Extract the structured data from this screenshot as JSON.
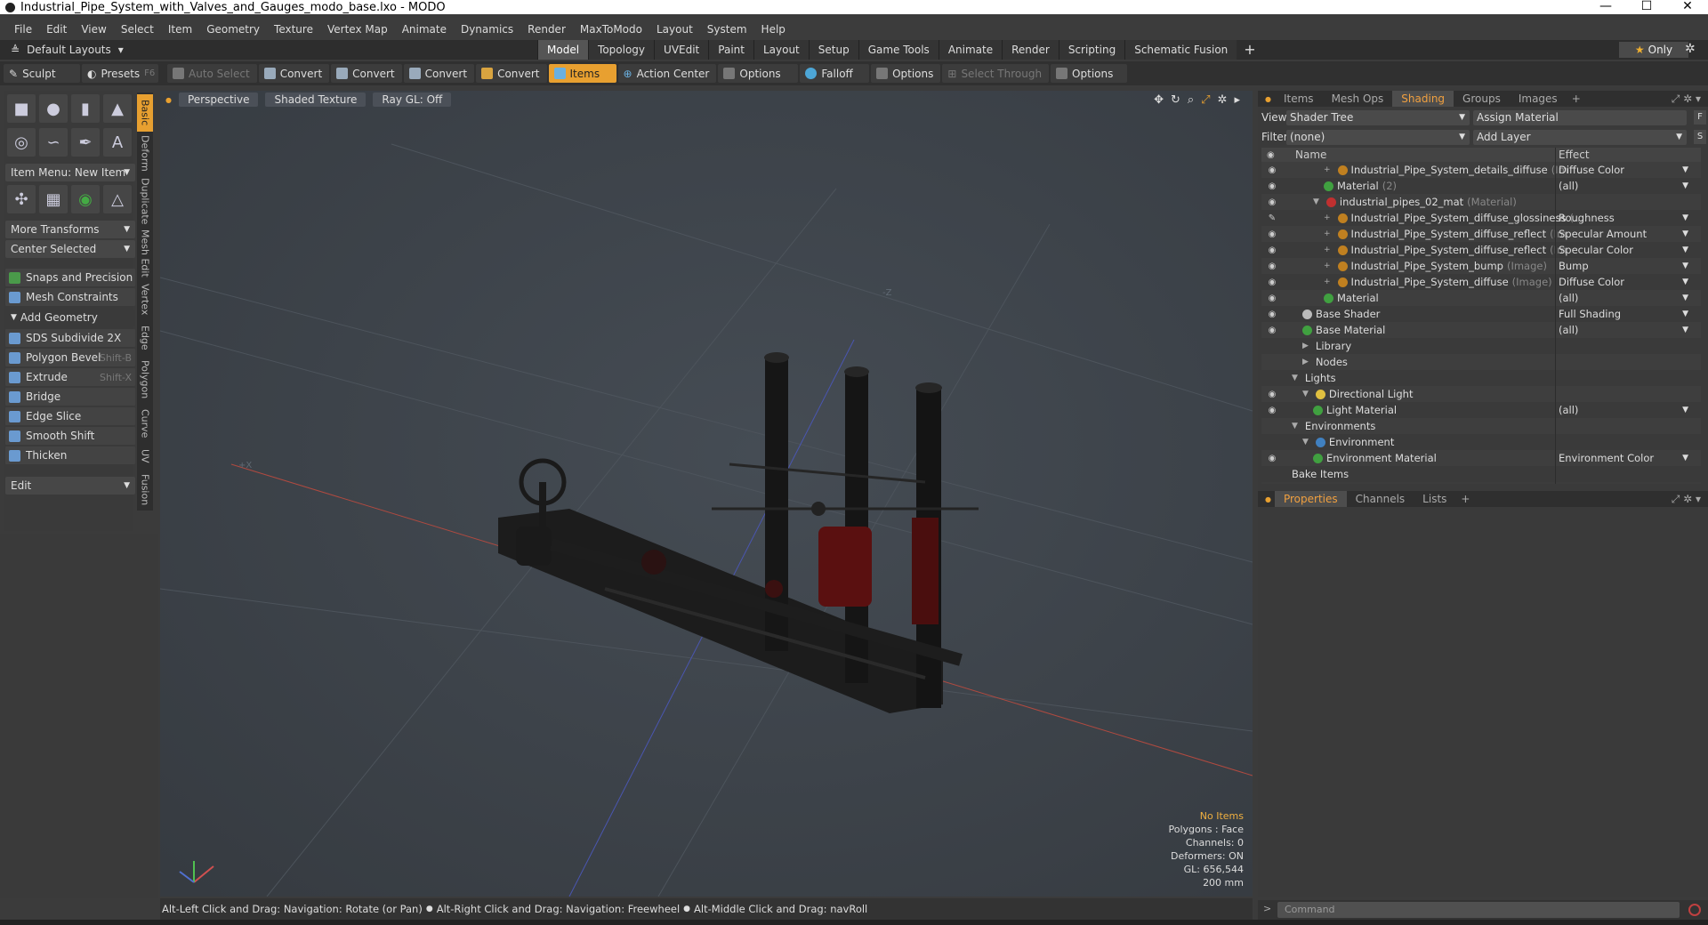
{
  "window": {
    "title": "Industrial_Pipe_System_with_Valves_and_Gauges_modo_base.lxo - MODO",
    "minimize": "—",
    "maximize": "☐",
    "close": "✕"
  },
  "menu": [
    "File",
    "Edit",
    "View",
    "Select",
    "Item",
    "Geometry",
    "Texture",
    "Vertex Map",
    "Animate",
    "Dynamics",
    "Render",
    "MaxToModo",
    "Layout",
    "System",
    "Help"
  ],
  "layouts": {
    "default": "Default Layouts",
    "tabs": [
      "Model",
      "Topology",
      "UVEdit",
      "Paint",
      "Layout",
      "Setup",
      "Game Tools",
      "Animate",
      "Render",
      "Scripting",
      "Schematic Fusion"
    ],
    "active": "Model",
    "only": "Only"
  },
  "toolbar": {
    "sculpt": "Sculpt",
    "presets": "Presets",
    "presets_key": "F6",
    "auto_select": "Auto Select",
    "convert1": "Convert",
    "convert2": "Convert",
    "convert3": "Convert",
    "convert4": "Convert",
    "items": "Items",
    "action_center": "Action Center",
    "options1": "Options",
    "falloff": "Falloff",
    "options2": "Options",
    "select_through": "Select Through",
    "options3": "Options"
  },
  "left": {
    "item_menu": "Item Menu: New Item",
    "more_transforms": "More Transforms",
    "center_selected": "Center Selected",
    "snaps": "Snaps and Precision",
    "mesh_constraints": "Mesh Constraints",
    "add_geometry": "Add Geometry",
    "sds": "SDS Subdivide 2X",
    "polygon_bevel": "Polygon Bevel",
    "polygon_bevel_key": "Shift-B",
    "extrude": "Extrude",
    "extrude_key": "Shift-X",
    "bridge": "Bridge",
    "edge_slice": "Edge Slice",
    "smooth_shift": "Smooth Shift",
    "thicken": "Thicken",
    "edit": "Edit"
  },
  "vtabs": [
    "Basic",
    "Deform",
    "Duplicate",
    "Mesh Edit",
    "Vertex",
    "Edge",
    "Polygon",
    "Curve",
    "UV",
    "Fusion"
  ],
  "viewport": {
    "perspective": "Perspective",
    "shaded": "Shaded Texture",
    "raygl": "Ray GL: Off",
    "axis_z": "-Z",
    "axis_x": "+X",
    "no_items": "No Items",
    "polygons": "Polygons : Face",
    "channels": "Channels: 0",
    "deformers": "Deformers: ON",
    "gl": "GL: 656,544",
    "scale": "200 mm"
  },
  "status": {
    "s1": "Alt-Left Click and Drag: Navigation: Rotate (or Pan)",
    "s2": "Alt-Right Click and Drag: Navigation: Freewheel",
    "s3": "Alt-Middle Click and Drag: navRoll"
  },
  "right": {
    "tabs": [
      "Items",
      "Mesh Ops",
      "Shading",
      "Groups",
      "Images"
    ],
    "active": "Shading",
    "view_label": "View",
    "view_value": "Shader Tree",
    "assign": "Assign Material",
    "f_btn": "F",
    "filter_label": "Filter",
    "filter_value": "(none)",
    "add_layer": "Add Layer",
    "s_btn": "S",
    "col_name": "Name",
    "col_effect": "Effect"
  },
  "tree": [
    {
      "name": "Industrial_Pipe_System_details_diffuse",
      "sub": "(Im",
      "effect": "Diffuse Color",
      "indent": 4,
      "ball": "#c08020",
      "eye": true,
      "plus": true
    },
    {
      "name": "Material",
      "sub": "(2)",
      "effect": "(all)",
      "indent": 4,
      "ball": "#40a040",
      "eye": true,
      "plus": false
    },
    {
      "name": "industrial_pipes_02_mat",
      "sub": "(Material)",
      "effect": "",
      "indent": 3,
      "ball": "#c03030",
      "eye": true,
      "plus": false,
      "open": true
    },
    {
      "name": "Industrial_Pipe_System_diffuse_glossiness",
      "sub": "(...",
      "effect": "Roughness",
      "indent": 4,
      "ball": "#c08020",
      "eye": true,
      "plus": true,
      "brush": true
    },
    {
      "name": "Industrial_Pipe_System_diffuse_reflect",
      "sub": "(Im",
      "effect": "Specular Amount",
      "indent": 4,
      "ball": "#c08020",
      "eye": true,
      "plus": true
    },
    {
      "name": "Industrial_Pipe_System_diffuse_reflect",
      "sub": "(Im",
      "effect": "Specular Color",
      "indent": 4,
      "ball": "#c08020",
      "eye": true,
      "plus": true
    },
    {
      "name": "Industrial_Pipe_System_bump",
      "sub": "(Image)",
      "effect": "Bump",
      "indent": 4,
      "ball": "#c08020",
      "eye": true,
      "plus": true
    },
    {
      "name": "Industrial_Pipe_System_diffuse",
      "sub": "(Image)",
      "effect": "Diffuse Color",
      "indent": 4,
      "ball": "#c08020",
      "eye": true,
      "plus": true
    },
    {
      "name": "Material",
      "sub": "",
      "effect": "(all)",
      "indent": 4,
      "ball": "#40a040",
      "eye": true,
      "plus": false
    },
    {
      "name": "Base Shader",
      "sub": "",
      "effect": "Full Shading",
      "indent": 2,
      "ball": "#bbbbbb",
      "eye": true,
      "plus": false
    },
    {
      "name": "Base Material",
      "sub": "",
      "effect": "(all)",
      "indent": 2,
      "ball": "#40a040",
      "eye": true,
      "plus": false
    },
    {
      "name": "Library",
      "sub": "",
      "effect": "",
      "indent": 2,
      "ball": "",
      "eye": false,
      "plus": false,
      "folder": true
    },
    {
      "name": "Nodes",
      "sub": "",
      "effect": "",
      "indent": 2,
      "ball": "",
      "eye": false,
      "plus": false,
      "folder": true
    },
    {
      "name": "Lights",
      "sub": "",
      "effect": "",
      "indent": 1,
      "ball": "",
      "eye": false,
      "plus": false,
      "open": true
    },
    {
      "name": "Directional Light",
      "sub": "",
      "effect": "",
      "indent": 2,
      "ball": "#e0c040",
      "eye": true,
      "plus": false,
      "open": true
    },
    {
      "name": "Light Material",
      "sub": "",
      "effect": "(all)",
      "indent": 3,
      "ball": "#40a040",
      "eye": true,
      "plus": false
    },
    {
      "name": "Environments",
      "sub": "",
      "effect": "",
      "indent": 1,
      "ball": "",
      "eye": false,
      "plus": false,
      "open": true
    },
    {
      "name": "Environment",
      "sub": "",
      "effect": "",
      "indent": 2,
      "ball": "#4080c0",
      "eye": false,
      "plus": false,
      "open": true
    },
    {
      "name": "Environment Material",
      "sub": "",
      "effect": "Environment Color",
      "indent": 3,
      "ball": "#40a040",
      "eye": true,
      "plus": false
    },
    {
      "name": "Bake Items",
      "sub": "",
      "effect": "",
      "indent": 1,
      "ball": "",
      "eye": false,
      "plus": false
    }
  ],
  "props": {
    "tabs": [
      "Properties",
      "Channels",
      "Lists"
    ],
    "active": "Properties",
    "command": "Command"
  }
}
